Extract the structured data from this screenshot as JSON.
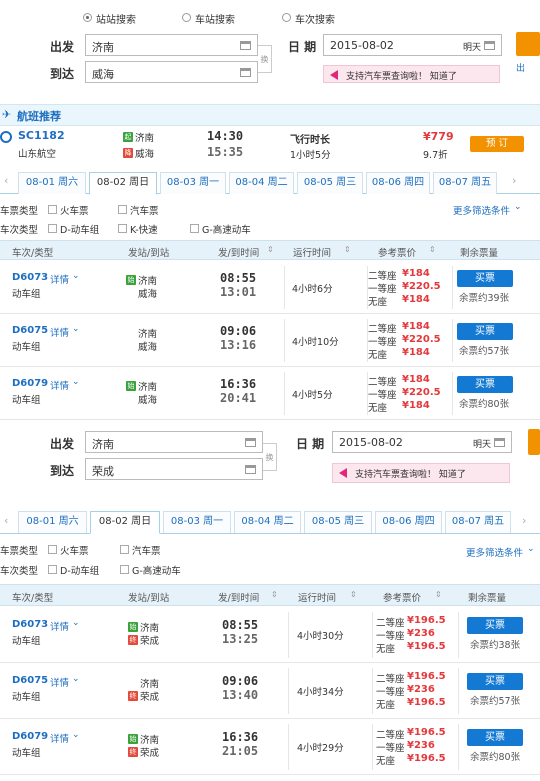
{
  "search_mode": {
    "options": [
      "站站搜索",
      "车站搜索",
      "车次搜索"
    ],
    "selected": 0
  },
  "form1": {
    "from_label": "出发",
    "from_value": "济南",
    "to_label": "到达",
    "to_value": "威海",
    "swap_label": "换",
    "date_label": "日 期",
    "date_value": "2015-08-02",
    "tomorrow": "明天",
    "notice_text": "支持汽车票查询啦！",
    "notice_dismiss": "知道了",
    "side_link": "出"
  },
  "flight_section": {
    "title": "航班推荐",
    "flight_no": "SC1182",
    "airline": "山东航空",
    "from_badge": "起",
    "from_city": "济南",
    "to_badge": "降",
    "to_city": "威海",
    "depart_time": "14:30",
    "arrive_time": "15:35",
    "duration_label": "飞行时长",
    "duration_value": "1小时5分",
    "price": "¥779",
    "discount": "9.7折",
    "book_label": "预 订"
  },
  "tabs1": [
    "08-01 周六",
    "08-02 周日",
    "08-03 周一",
    "08-04 周二",
    "08-05 周三",
    "08-06 周四",
    "08-07 周五"
  ],
  "filters1": {
    "ticket_type_label": "车票类型",
    "train_ticket": "火车票",
    "bus_ticket": "汽车票",
    "train_type_label": "车次类型",
    "d_train": "D-动车组",
    "k_train": "K-快速",
    "g_train": "G-高速动车",
    "more": "更多筛选条件"
  },
  "table_headers": [
    "车次/类型",
    "发站/到站",
    "发/到时间",
    "运行时间",
    "参考票价",
    "剩余票量"
  ],
  "seat_labels": [
    "二等座",
    "一等座",
    "无座"
  ],
  "buy_label": "买票",
  "detail_label": "详情",
  "trains1": [
    {
      "no": "D6073",
      "type": "动车组",
      "from_badge": "始",
      "from": "济南",
      "to_badge": "",
      "to": "威海",
      "dep": "08:55",
      "arr": "13:01",
      "dur": "4小时6分",
      "prices": [
        "¥184",
        "¥220.5",
        "¥184"
      ],
      "left": "余票约39张"
    },
    {
      "no": "D6075",
      "type": "动车组",
      "from_badge": "",
      "from": "济南",
      "to_badge": "",
      "to": "威海",
      "dep": "09:06",
      "arr": "13:16",
      "dur": "4小时10分",
      "prices": [
        "¥184",
        "¥220.5",
        "¥184"
      ],
      "left": "余票约57张"
    },
    {
      "no": "D6079",
      "type": "动车组",
      "from_badge": "始",
      "from": "济南",
      "to_badge": "",
      "to": "威海",
      "dep": "16:36",
      "arr": "20:41",
      "dur": "4小时5分",
      "prices": [
        "¥184",
        "¥220.5",
        "¥184"
      ],
      "left": "余票约80张"
    }
  ],
  "form2": {
    "from_label": "出发",
    "from_value": "济南",
    "to_label": "到达",
    "to_value": "荣成",
    "swap_label": "换",
    "date_label": "日 期",
    "date_value": "2015-08-02",
    "tomorrow": "明天",
    "notice_text": "支持汽车票查询啦！",
    "notice_dismiss": "知道了"
  },
  "tabs2": [
    "08-01 周六",
    "08-02 周日",
    "08-03 周一",
    "08-04 周二",
    "08-05 周三",
    "08-06 周四",
    "08-07 周五"
  ],
  "filters2": {
    "ticket_type_label": "车票类型",
    "train_ticket": "火车票",
    "bus_ticket": "汽车票",
    "train_type_label": "车次类型",
    "d_train": "D-动车组",
    "g_train": "G-高速动车",
    "more": "更多筛选条件"
  },
  "trains2": [
    {
      "no": "D6073",
      "type": "动车组",
      "from_badge": "始",
      "from": "济南",
      "to_badge": "终",
      "to": "荣成",
      "dep": "08:55",
      "arr": "13:25",
      "dur": "4小时30分",
      "prices": [
        "¥196.5",
        "¥236",
        "¥196.5"
      ],
      "left": "余票约38张"
    },
    {
      "no": "D6075",
      "type": "动车组",
      "from_badge": "",
      "from": "济南",
      "to_badge": "终",
      "to": "荣成",
      "dep": "09:06",
      "arr": "13:40",
      "dur": "4小时34分",
      "prices": [
        "¥196.5",
        "¥236",
        "¥196.5"
      ],
      "left": "余票约57张"
    },
    {
      "no": "D6079",
      "type": "动车组",
      "from_badge": "始",
      "from": "济南",
      "to_badge": "终",
      "to": "荣成",
      "dep": "16:36",
      "arr": "21:05",
      "dur": "4小时29分",
      "prices": [
        "¥196.5",
        "¥236",
        "¥196.5"
      ],
      "left": "余票约80张"
    }
  ]
}
